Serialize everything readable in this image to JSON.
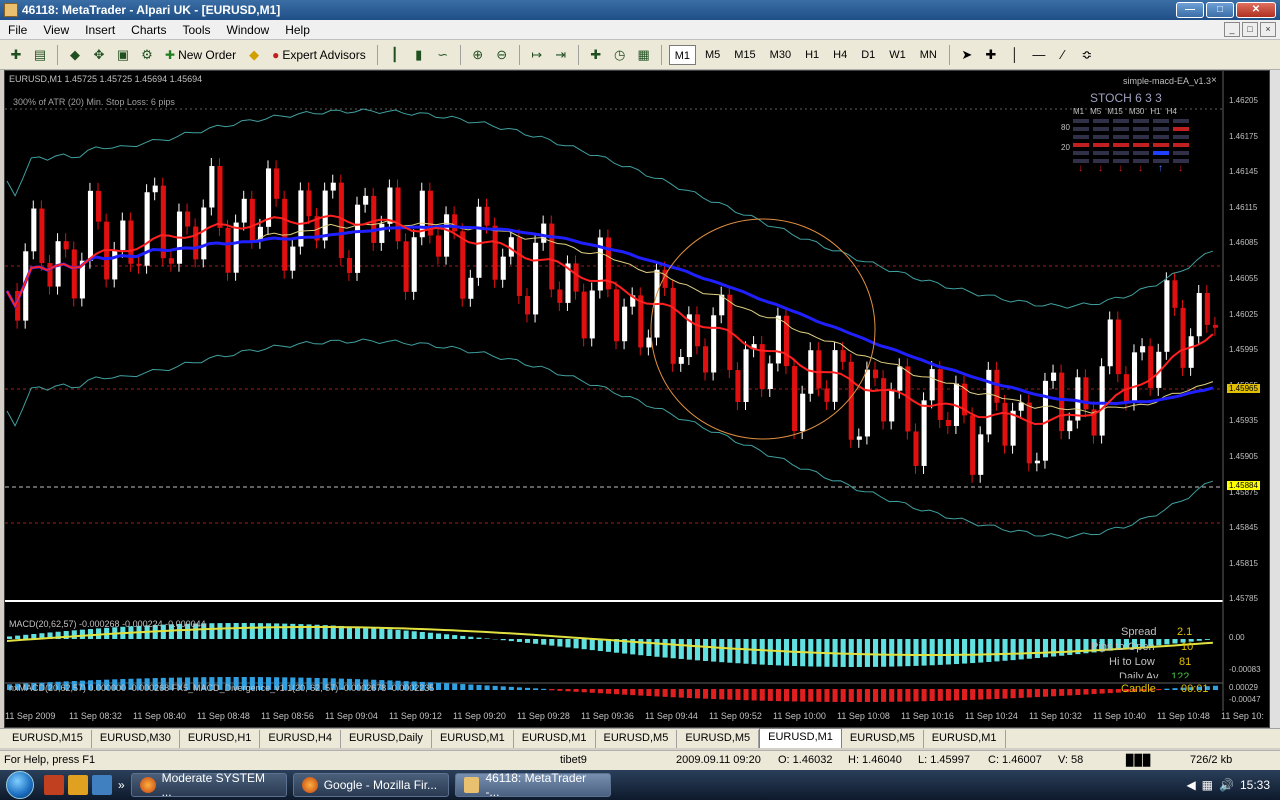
{
  "window": {
    "title": "46118: MetaTrader - Alpari UK - [EURUSD,M1]"
  },
  "menu": [
    "File",
    "View",
    "Insert",
    "Charts",
    "Tools",
    "Window",
    "Help"
  ],
  "toolbar": {
    "new_order": "New Order",
    "expert_advisors": "Expert Advisors",
    "timeframes": [
      "M1",
      "M5",
      "M15",
      "M30",
      "H1",
      "H4",
      "D1",
      "W1",
      "MN"
    ],
    "active_timeframe": "M1"
  },
  "chart": {
    "header": "EURUSD,M1  1.45725 1.45725 1.45694 1.45694",
    "sub": "300% of ATR (20)    Min. Stop Loss:   6 pips",
    "ea_name": "simple-macd-EA_v1.3",
    "stoch_title": "STOCH  6 3 3",
    "stoch_timeframes": [
      "M1",
      "M5",
      "M15",
      "M30",
      "H1",
      "H4"
    ],
    "stoch_levels": [
      "80",
      "20"
    ],
    "price_labels": [
      "1.46205",
      "1.46175",
      "1.46145",
      "1.46115",
      "1.46085",
      "1.46055",
      "1.46025",
      "1.45995",
      "1.45965",
      "1.45935",
      "1.45905",
      "1.45875",
      "1.45845",
      "1.45815",
      "1.45785"
    ],
    "tag_upper": "1.45965",
    "tag_current": "1.45884",
    "macd_label": "MACD(20,62,57) -0.000268 -0.000224 -0.000044",
    "macd_levels": [
      "0.00",
      "-0.00083"
    ],
    "nx_label": "nxMACD(20,62,57) 0.000000 -0.000268  FX5_MACD_Divergence_v1.1(20, 62, 57) -0.0002678 -0.0002235",
    "nx_levels": [
      "0.00029",
      "-0.00047"
    ],
    "info": {
      "spread_label": "Spread",
      "spread_value": "2.1",
      "pips_label": "Pips to Open",
      "pips_value": "10",
      "hilo_label": "Hi to Low",
      "hilo_value": "81",
      "daily_label": "Daily Av",
      "daily_value": "122",
      "candle_label": "Candle",
      "candle_value": "00:01"
    },
    "time_labels": [
      "11 Sep 2009",
      "11 Sep 08:32",
      "11 Sep 08:40",
      "11 Sep 08:48",
      "11 Sep 08:56",
      "11 Sep 09:04",
      "11 Sep 09:12",
      "11 Sep 09:20",
      "11 Sep 09:28",
      "11 Sep 09:36",
      "11 Sep 09:44",
      "11 Sep 09:52",
      "11 Sep 10:00",
      "11 Sep 10:08",
      "11 Sep 10:16",
      "11 Sep 10:24",
      "11 Sep 10:32",
      "11 Sep 10:40",
      "11 Sep 10:48",
      "11 Sep 10:"
    ]
  },
  "tabs": [
    "EURUSD,M15",
    "EURUSD,M30",
    "EURUSD,H1",
    "EURUSD,H4",
    "EURUSD,Daily",
    "EURUSD,M1",
    "EURUSD,M1",
    "EURUSD,M5",
    "EURUSD,M5",
    "EURUSD,M1",
    "EURUSD,M5",
    "EURUSD,M1"
  ],
  "active_tab_index": 9,
  "status": {
    "help": "For Help, press F1",
    "profile": "tibet9",
    "datetime": "2009.09.11 09:20",
    "open": "O: 1.46032",
    "high": "H: 1.46040",
    "low": "L: 1.45997",
    "close": "C: 1.46007",
    "volume": "V: 58",
    "traffic": "726/2 kb"
  },
  "taskbar": {
    "tasks": [
      "Moderate SYSTEM ...",
      "Google - Mozilla Fir...",
      "46118: MetaTrader -..."
    ],
    "clock": "15:33"
  },
  "colors": {
    "bull": "#ffffff",
    "bear": "#e01010",
    "ma_blue": "#2020ff",
    "ma_red": "#ff2020",
    "ma_yellow": "#e0d080",
    "band": "#40a0a0",
    "circle": "#e09040"
  }
}
